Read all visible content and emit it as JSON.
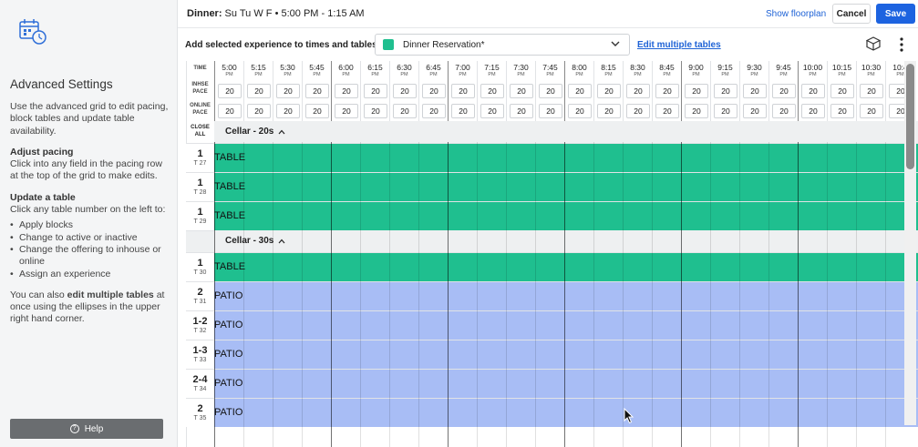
{
  "sidebar": {
    "icon": "calendar-clock-icon",
    "title": "Advanced Settings",
    "intro": "Use the advanced grid to edit pacing, block tables and update table availability.",
    "sections": [
      {
        "heading": "Adjust pacing",
        "text": "Click into any field in the pacing row at the top of the grid to make edits."
      },
      {
        "heading": "Update a table",
        "text": "Click any table number on the left to:"
      }
    ],
    "bullets": [
      "Apply blocks",
      "Change to active or inactive",
      "Change the offering to inhouse or online",
      "Assign an experience"
    ],
    "footer_prefix": "You can also ",
    "footer_bold": "edit multiple tables",
    "footer_suffix": " at once using the ellipses in the upper right hand corner.",
    "help_label": "Help"
  },
  "header": {
    "shift_label": "Dinner:",
    "shift_detail": " Su Tu W F • 5:00 PM - 1:15 AM",
    "floorplan_link": "Show floorplan",
    "cancel_label": "Cancel",
    "save_label": "Save"
  },
  "toolbar": {
    "label": "Add selected experience to times and tables",
    "experience": "Dinner Reservation*",
    "experience_color": "#1fbf8f",
    "edit_multiple": "Edit multiple tables"
  },
  "grid": {
    "labels": {
      "time": "TIME",
      "inhouse_1": "INHSE",
      "inhouse_2": "PACE",
      "online_1": "ONLINE",
      "online_2": "PACE",
      "close_1": "CLOSE",
      "close_2": "ALL"
    },
    "times": [
      {
        "t": "5:00",
        "p": "PM",
        "hour": true
      },
      {
        "t": "5:15",
        "p": "PM"
      },
      {
        "t": "5:30",
        "p": "PM"
      },
      {
        "t": "5:45",
        "p": "PM"
      },
      {
        "t": "6:00",
        "p": "PM",
        "hour": true
      },
      {
        "t": "6:15",
        "p": "PM"
      },
      {
        "t": "6:30",
        "p": "PM"
      },
      {
        "t": "6:45",
        "p": "PM"
      },
      {
        "t": "7:00",
        "p": "PM",
        "hour": true
      },
      {
        "t": "7:15",
        "p": "PM"
      },
      {
        "t": "7:30",
        "p": "PM"
      },
      {
        "t": "7:45",
        "p": "PM"
      },
      {
        "t": "8:00",
        "p": "PM",
        "hour": true
      },
      {
        "t": "8:15",
        "p": "PM"
      },
      {
        "t": "8:30",
        "p": "PM"
      },
      {
        "t": "8:45",
        "p": "PM"
      },
      {
        "t": "9:00",
        "p": "PM",
        "hour": true
      },
      {
        "t": "9:15",
        "p": "PM"
      },
      {
        "t": "9:30",
        "p": "PM"
      },
      {
        "t": "9:45",
        "p": "PM"
      },
      {
        "t": "10:00",
        "p": "PM",
        "hour": true
      },
      {
        "t": "10:15",
        "p": "PM"
      },
      {
        "t": "10:30",
        "p": "PM"
      },
      {
        "t": "10:4",
        "p": "PM"
      }
    ],
    "inhouse_pace": "20",
    "online_pace": "20",
    "table_color": "#1fbf8f",
    "patio_color": "#a8bdf5",
    "sections": [
      {
        "title": "Cellar - 20s",
        "rows": [
          {
            "num": "1",
            "tid": "T 27",
            "label": "TABLE",
            "kind": "table"
          },
          {
            "num": "1",
            "tid": "T 28",
            "label": "TABLE",
            "kind": "table"
          },
          {
            "num": "1",
            "tid": "T 29",
            "label": "TABLE",
            "kind": "table"
          }
        ]
      },
      {
        "title": "Cellar - 30s",
        "rows": [
          {
            "num": "1",
            "tid": "T 30",
            "label": "TABLE",
            "kind": "table"
          },
          {
            "num": "2",
            "tid": "T 31",
            "label": "PATIO",
            "kind": "patio"
          },
          {
            "num": "1-2",
            "tid": "T 32",
            "label": "PATIO",
            "kind": "patio"
          },
          {
            "num": "1-3",
            "tid": "T 33",
            "label": "PATIO",
            "kind": "patio"
          },
          {
            "num": "2-4",
            "tid": "T 34",
            "label": "PATIO",
            "kind": "patio"
          },
          {
            "num": "2",
            "tid": "T 35",
            "label": "PATIO",
            "kind": "patio"
          }
        ]
      }
    ]
  }
}
